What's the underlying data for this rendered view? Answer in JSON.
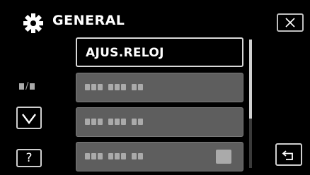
{
  "header": {
    "title": "GENERAL",
    "icon": "gear-icon"
  },
  "menu": {
    "items": [
      {
        "label": "AJUS.RELOJ",
        "selected": true
      },
      {
        "label": "",
        "selected": false,
        "obscured": true
      },
      {
        "label": "",
        "selected": false,
        "obscured": true
      },
      {
        "label": "",
        "selected": false,
        "obscured": true
      }
    ]
  },
  "scroll": {
    "position_fraction": 0.0,
    "visible_fraction": 0.6
  },
  "controls": {
    "close_icon": "close-icon",
    "down_icon": "chevron-down-icon",
    "help_label": "?",
    "return_icon": "return-icon"
  },
  "colors": {
    "background": "#000000",
    "selected_item_border": "#d8d8d8",
    "item_fill": "#5e5e5e"
  }
}
